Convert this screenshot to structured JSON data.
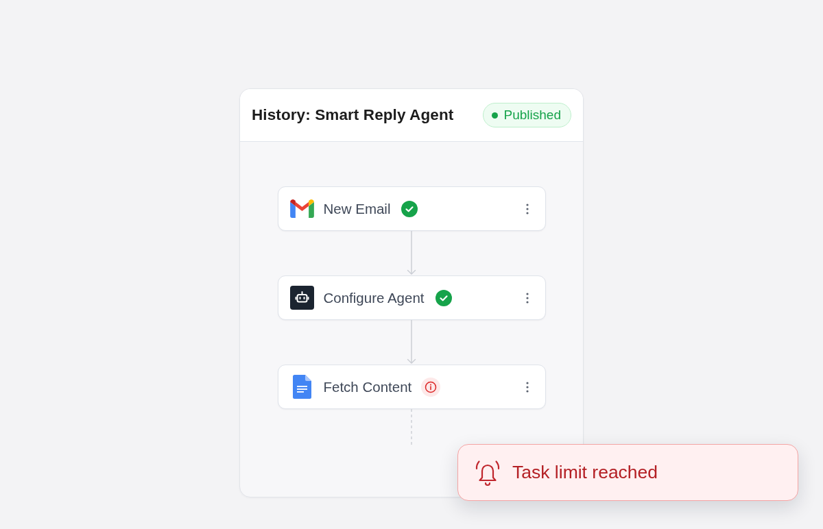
{
  "panel": {
    "title": "History: Smart Reply Agent",
    "status_badge": {
      "label": "Published"
    }
  },
  "nodes": [
    {
      "kind": "email",
      "label": "New Email",
      "succeeded": true
    },
    {
      "kind": "agent",
      "label": "Configure Agent",
      "succeeded": true
    },
    {
      "kind": "document",
      "label": "Fetch Content",
      "succeeded": false
    }
  ],
  "toast": {
    "message": "Task limit reached"
  }
}
